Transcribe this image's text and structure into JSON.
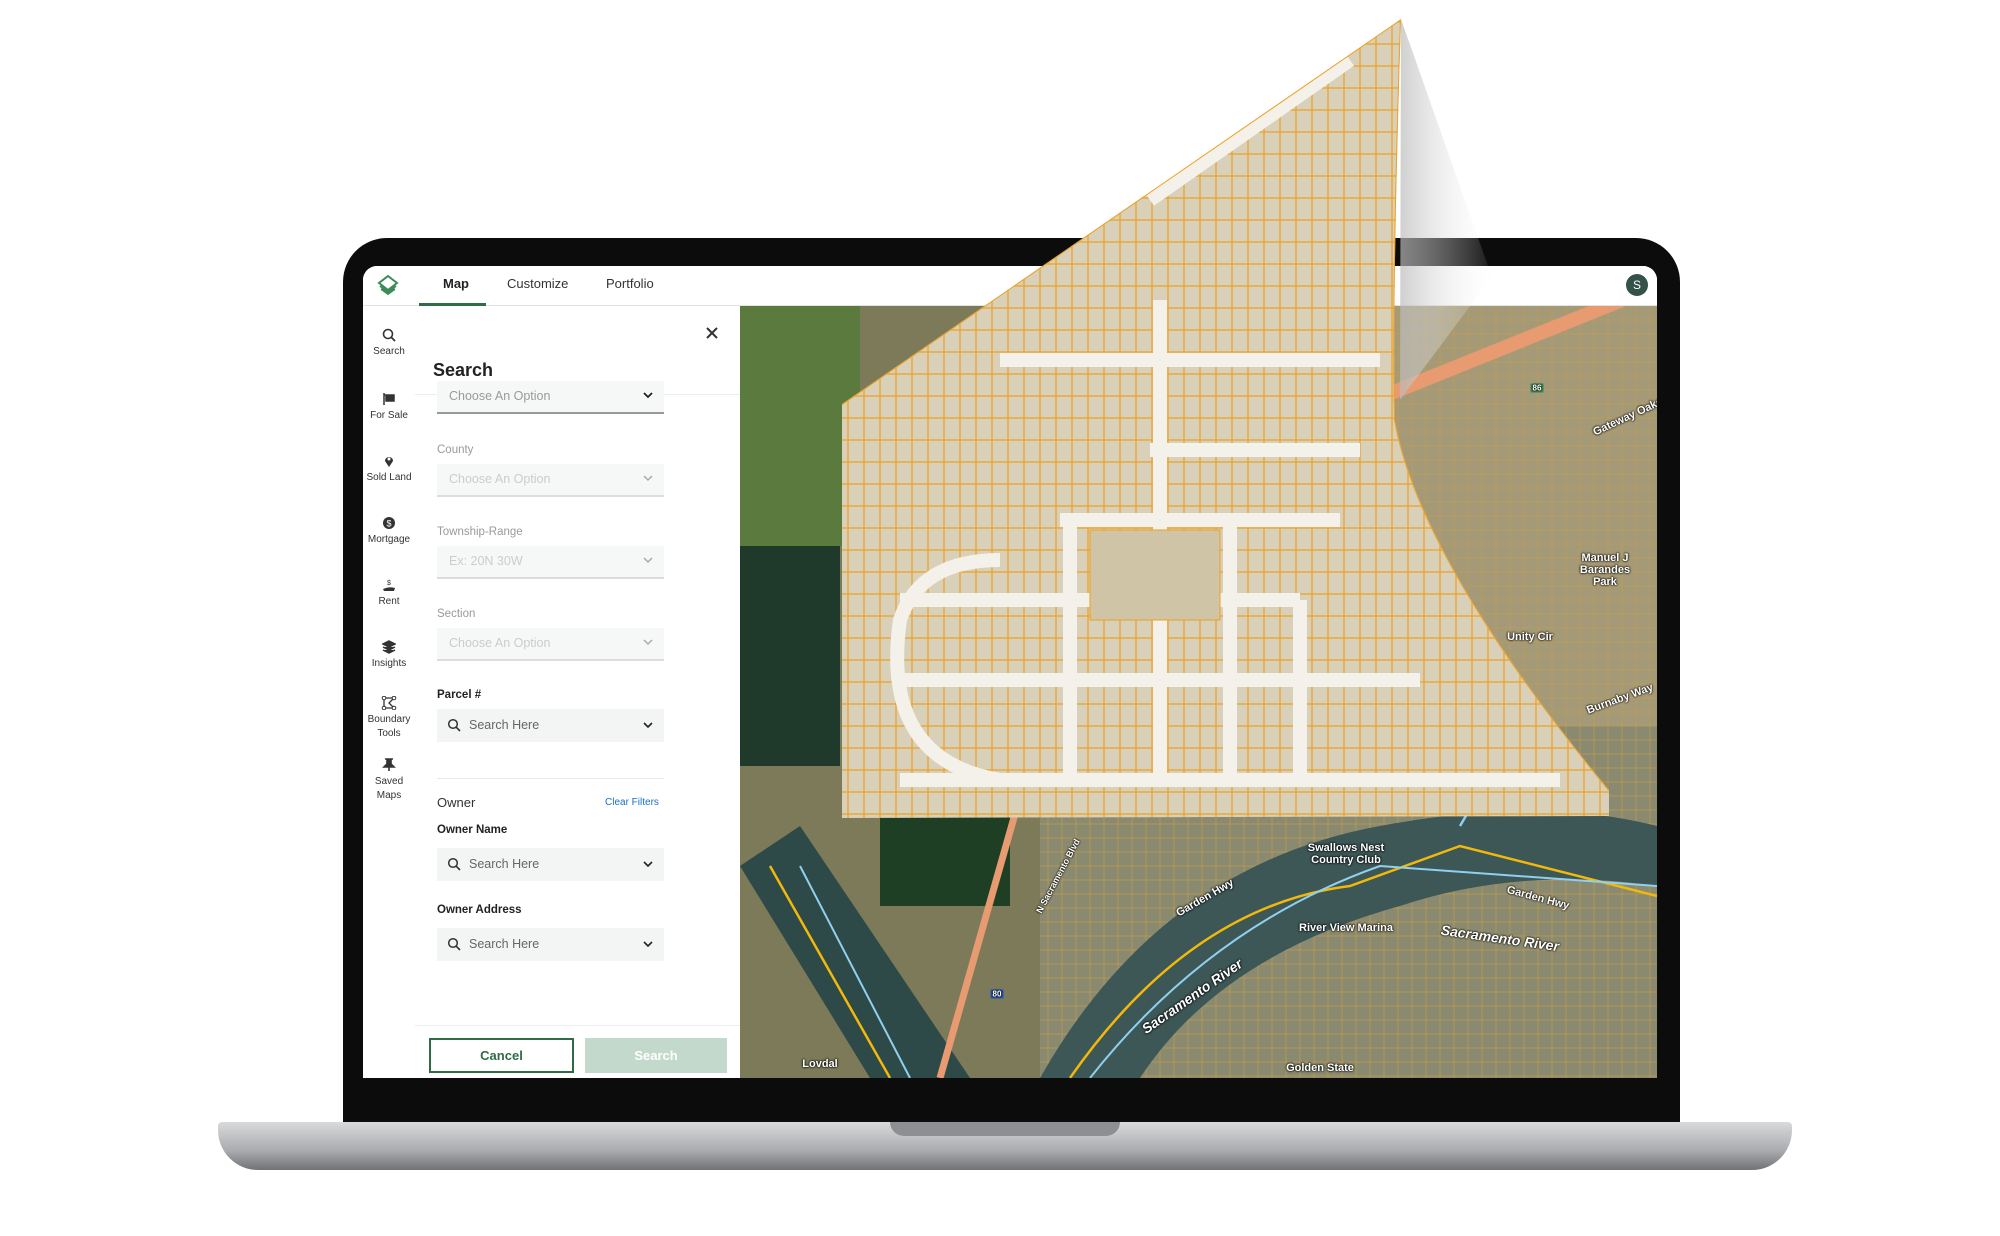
{
  "nav": {
    "tabs": [
      {
        "label": "Map",
        "active": true
      },
      {
        "label": "Customize"
      },
      {
        "label": "Portfolio"
      }
    ],
    "avatar": "S"
  },
  "sidebar": {
    "items": [
      {
        "label": "Search",
        "icon": "search-icon"
      },
      {
        "label": "For Sale",
        "icon": "flag-icon"
      },
      {
        "label": "Sold Land",
        "icon": "map-pin-icon"
      },
      {
        "label": "Mortgage",
        "icon": "dollar-circle-icon"
      },
      {
        "label": "Rent",
        "icon": "hand-dollar-icon"
      },
      {
        "label": "Insights",
        "icon": "layers-icon"
      },
      {
        "label": "Boundary",
        "label2": "Tools",
        "icon": "polygon-icon"
      },
      {
        "label": "Saved",
        "label2": "Maps",
        "icon": "pin-icon"
      }
    ]
  },
  "panel": {
    "title": "Search",
    "first_select": "Choose An Option",
    "county": {
      "label": "County",
      "placeholder": "Choose An Option"
    },
    "township": {
      "label": "Township-Range",
      "placeholder": "Ex: 20N 30W"
    },
    "section": {
      "label": "Section",
      "placeholder": "Choose An Option"
    },
    "parcel": {
      "label": "Parcel #",
      "placeholder": "Search Here"
    },
    "owner": {
      "heading": "Owner",
      "clear": "Clear Filters"
    },
    "owner_name": {
      "label": "Owner Name",
      "placeholder": "Search Here"
    },
    "owner_address": {
      "label": "Owner Address",
      "placeholder": "Search Here"
    },
    "cancel": "Cancel",
    "search": "Search"
  },
  "map": {
    "labels": [
      "Swallows Nest Country Club",
      "River View Marina",
      "Sacramento River",
      "Sacramento River",
      "Garden Hwy",
      "Garden Hwy",
      "Lovdal",
      "Golden State",
      "Manuel J Barandes Park",
      "Gateway Oaks",
      "Unity Cir",
      "Burnaby Way",
      "80",
      "86",
      "N Sacramento Blvd"
    ]
  },
  "colors": {
    "accent": "#2f6b45",
    "parcel_line": "#f0a020",
    "search_button": "#c3d9cc",
    "link": "#1a6fc9"
  }
}
